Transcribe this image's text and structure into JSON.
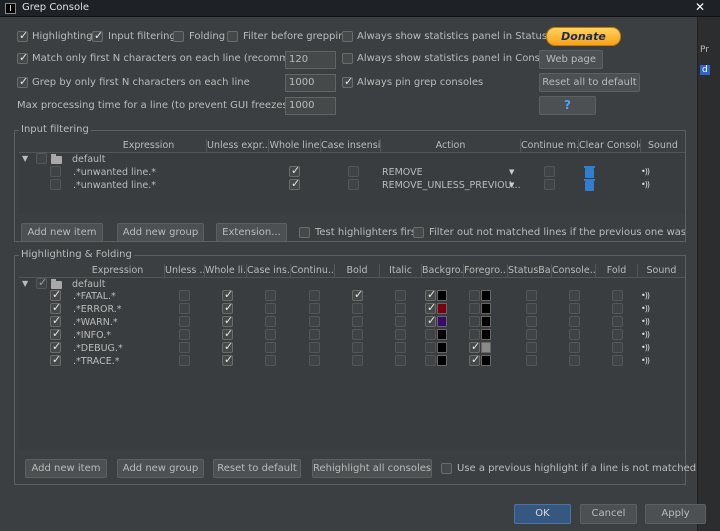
{
  "window": {
    "title": "Grep Console",
    "close_glyph": "✕"
  },
  "options": {
    "highlighting": {
      "label": "Highlighting",
      "checked": true
    },
    "input_filtering": {
      "label": "Input filtering",
      "checked": true
    },
    "folding": {
      "label": "Folding",
      "checked": false
    },
    "filter_before_grepping": {
      "label": "Filter before grepping",
      "checked": false
    },
    "stats_status_bar": {
      "label": "Always show statistics panel in Status Bar",
      "checked": false
    },
    "match_first_n": {
      "label": "Match only first N characters on each line (recommended)",
      "checked": true,
      "value": "120"
    },
    "stats_console": {
      "label": "Always show statistics panel in Console",
      "checked": false
    },
    "grep_first_n": {
      "label": "Grep by only first N characters on each line",
      "checked": true,
      "value": "1000"
    },
    "pin_grep": {
      "label": "Always pin grep consoles",
      "checked": true
    },
    "max_time": {
      "label": "Max processing time for a line (to prevent GUI freezes) [ms]",
      "value": "1000"
    }
  },
  "buttons": {
    "donate": "Donate",
    "web_page": "Web page",
    "reset_all": "Reset all to default",
    "help": "?"
  },
  "input_filtering": {
    "title": "Input filtering",
    "columns": [
      "Expression",
      "Unless expr...",
      "Whole line",
      "Case insensi...",
      "Action",
      "Continue m...",
      "Clear Console",
      "Sound"
    ],
    "group": "default",
    "rows": [
      {
        "expression": ".*unwanted line.*",
        "whole_line": true,
        "case_insensitive": false,
        "action": "REMOVE",
        "continue": false
      },
      {
        "expression": ".*unwanted line.*",
        "whole_line": true,
        "case_insensitive": false,
        "action": "REMOVE_UNLESS_PREVIOU...",
        "continue": false
      }
    ],
    "add_item": "Add new item",
    "add_group": "Add new group",
    "extension": "Extension...",
    "test_first": {
      "label": "Test highlighters first",
      "checked": false
    },
    "filter_out": {
      "label": "Filter out not matched lines if the previous one was filtered o",
      "checked": false
    }
  },
  "highlighting": {
    "title": "Highlighting & Folding",
    "columns": [
      "Expression",
      "Unless ...",
      "Whole li...",
      "Case ins...",
      "Continu...",
      "Bold",
      "Italic",
      "Backgro...",
      "Foregro...",
      "StatusBa...",
      "Console...",
      "Fold",
      "Sound"
    ],
    "group": "default",
    "rows": [
      {
        "expression": ".*FATAL.*",
        "enabled": true,
        "whole_line": true,
        "bold": true,
        "bg_on": true,
        "bg": "#000000",
        "fg_on": false,
        "fg": "#000000"
      },
      {
        "expression": ".*ERROR.*",
        "enabled": true,
        "whole_line": true,
        "bold": false,
        "bg_on": true,
        "bg": "#7a0010",
        "fg_on": false,
        "fg": "#000000"
      },
      {
        "expression": ".*WARN.*",
        "enabled": true,
        "whole_line": true,
        "bold": false,
        "bg_on": true,
        "bg": "#3a0a6a",
        "fg_on": false,
        "fg": "#000000"
      },
      {
        "expression": ".*INFO.*",
        "enabled": true,
        "whole_line": true,
        "bold": false,
        "bg_on": false,
        "bg": "#000000",
        "fg_on": false,
        "fg": "#000000"
      },
      {
        "expression": ".*DEBUG.*",
        "enabled": true,
        "whole_line": true,
        "bold": false,
        "bg_on": false,
        "bg": "#000000",
        "fg_on": true,
        "fg": "#8a8a8a"
      },
      {
        "expression": ".*TRACE.*",
        "enabled": true,
        "whole_line": true,
        "bold": false,
        "bg_on": false,
        "bg": "#000000",
        "fg_on": true,
        "fg": "#000000"
      }
    ],
    "add_item": "Add new item",
    "add_group": "Add new group",
    "reset": "Reset to default",
    "rehighlight": "Rehighlight all consoles",
    "use_previous": {
      "label": "Use a previous highlight if a line is not matched",
      "checked": false
    }
  },
  "footer": {
    "ok": "OK",
    "cancel": "Cancel",
    "apply": "Apply"
  },
  "right_panel": {
    "tab_label": "Pr",
    "selected_label": "d"
  }
}
